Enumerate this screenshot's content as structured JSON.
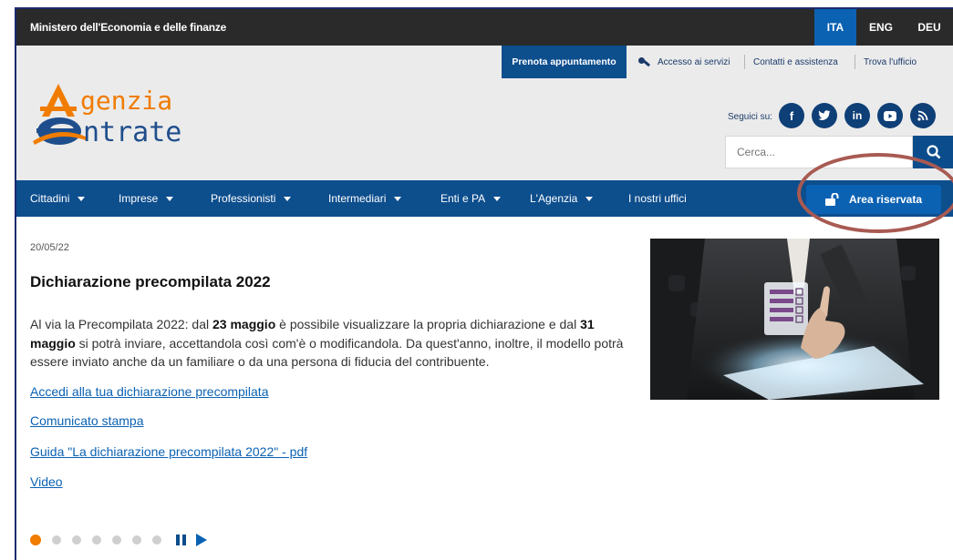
{
  "topbar": {
    "ministry": "Ministero dell'Economia e delle finanze",
    "languages": [
      {
        "label": "ITA",
        "active": true
      },
      {
        "label": "ENG",
        "active": false
      },
      {
        "label": "DEU",
        "active": false
      }
    ]
  },
  "header": {
    "prenota": "Prenota appuntamento",
    "accesso": "Accesso ai servizi",
    "contatti": "Contatti e assistenza",
    "trova": "Trova l'ufficio",
    "logo_line1": "genzia",
    "logo_line2": "ntrate",
    "seguici": "Seguici su:",
    "social_icons": [
      "facebook-icon",
      "twitter-icon",
      "linkedin-icon",
      "youtube-icon",
      "rss-icon"
    ],
    "search_placeholder": "Cerca..."
  },
  "nav": {
    "items": [
      "Cittadini",
      "Imprese",
      "Professionisti",
      "Intermediari",
      "Enti e PA",
      "L'Agenzia",
      "I nostri uffici"
    ],
    "area_riservata": "Area riservata"
  },
  "news": {
    "date": "20/05/22",
    "title": "Dichiarazione precompilata 2022",
    "p1": "Al via la Precompilata 2022: dal ",
    "b1": "23 maggio",
    "p2": " è possibile visualizzare la propria dichiarazione e dal ",
    "b2": "31 maggio",
    "p3": " si potrà inviare, accettandola così com'è o modificandola. Da quest'anno, inoltre, il modello potrà essere inviato anche da un familiare o da una persona di fiducia del contribuente.",
    "links": [
      "Accedi alla tua dichiarazione precompilata",
      "Comunicato stampa",
      "Guida \"La dichiarazione precompilata 2022\" - pdf",
      "Video"
    ]
  },
  "carousel": {
    "slides": 7,
    "active": 1
  },
  "colors": {
    "brand_blue": "#0d4e8d",
    "accent_blue": "#0b62b3",
    "orange": "#f07c00",
    "dark": "#2a2a2a",
    "highlight_ring": "#a85a52"
  }
}
